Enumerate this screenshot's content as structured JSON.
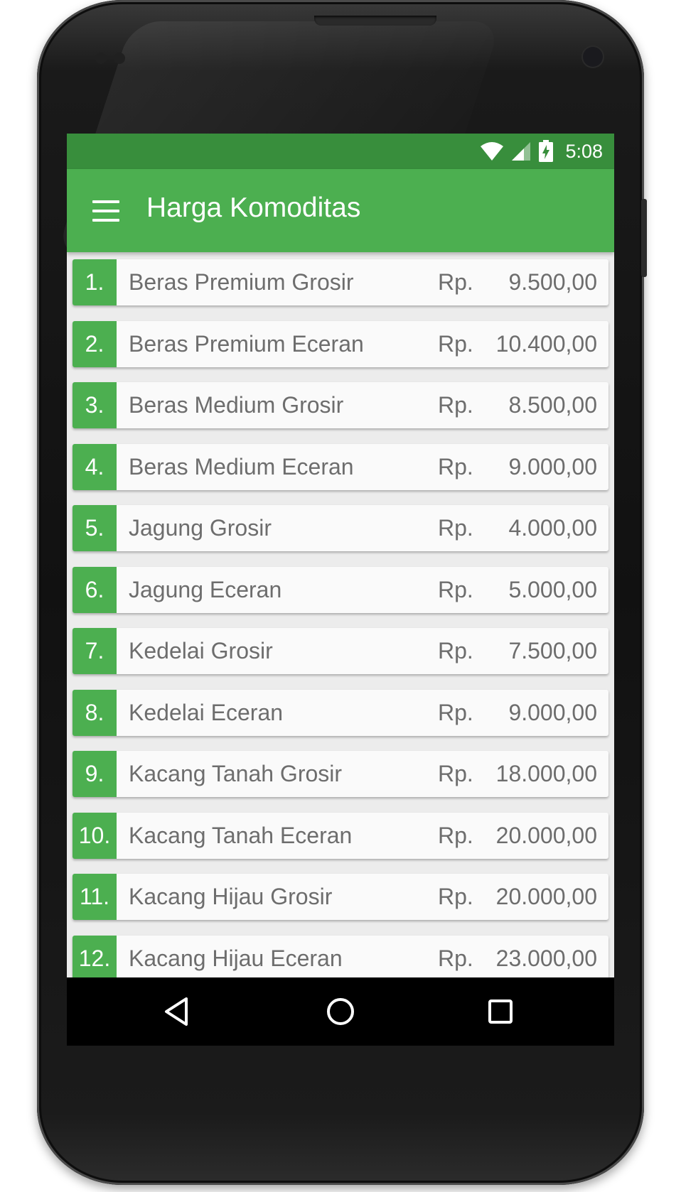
{
  "status": {
    "time": "5:08",
    "icons": [
      "wifi-icon",
      "cell-signal-icon",
      "battery-charging-icon"
    ]
  },
  "appbar": {
    "title": "Harga Komoditas",
    "menu_icon": "menu-icon"
  },
  "items": [
    {
      "num": "1.",
      "name": "Beras Premium Grosir",
      "currency": "Rp.",
      "price": "9.500,00"
    },
    {
      "num": "2.",
      "name": "Beras Premium Eceran",
      "currency": "Rp.",
      "price": "10.400,00"
    },
    {
      "num": "3.",
      "name": "Beras Medium Grosir",
      "currency": "Rp.",
      "price": "8.500,00"
    },
    {
      "num": "4.",
      "name": "Beras Medium Eceran",
      "currency": "Rp.",
      "price": "9.000,00"
    },
    {
      "num": "5.",
      "name": "Jagung Grosir",
      "currency": "Rp.",
      "price": "4.000,00"
    },
    {
      "num": "6.",
      "name": "Jagung Eceran",
      "currency": "Rp.",
      "price": "5.000,00"
    },
    {
      "num": "7.",
      "name": "Kedelai Grosir",
      "currency": "Rp.",
      "price": "7.500,00"
    },
    {
      "num": "8.",
      "name": "Kedelai Eceran",
      "currency": "Rp.",
      "price": "9.000,00"
    },
    {
      "num": "9.",
      "name": "Kacang Tanah Grosir",
      "currency": "Rp.",
      "price": "18.000,00"
    },
    {
      "num": "10.",
      "name": "Kacang Tanah Eceran",
      "currency": "Rp.",
      "price": "20.000,00"
    },
    {
      "num": "11.",
      "name": "Kacang Hijau Grosir",
      "currency": "Rp.",
      "price": "20.000,00"
    },
    {
      "num": "12.",
      "name": "Kacang Hijau Eceran",
      "currency": "Rp.",
      "price": "23.000,00"
    }
  ],
  "navbar": {
    "buttons": [
      "back-icon",
      "home-icon",
      "recents-icon"
    ]
  },
  "colors": {
    "primary": "#4caf50",
    "primary_dark": "#388e3c",
    "row_background": "#fafafa",
    "row_text": "#6d6d6d"
  }
}
